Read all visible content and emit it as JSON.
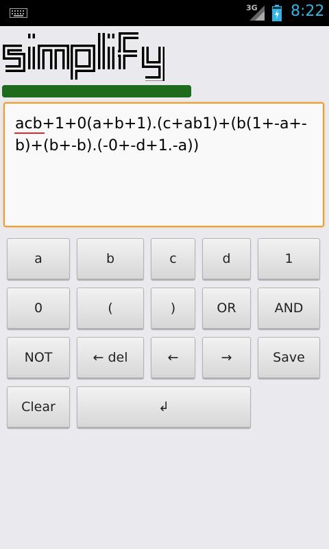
{
  "status_bar": {
    "network": "3G",
    "time": "8:22"
  },
  "app": {
    "title": "simplify",
    "progress_fraction": 1.0
  },
  "expression": {
    "underlined_part": "acb",
    "rest": "+1+0(a+b+1).(c+ab1)+(b(1+-a+-b)+(b+-b).(-0+-d+1.-a))"
  },
  "keypad": {
    "a": "a",
    "b": "b",
    "c": "c",
    "d": "d",
    "one": "1",
    "zero": "0",
    "open_paren": "(",
    "close_paren": ")",
    "or": "OR",
    "and": "AND",
    "not": "NOT",
    "del": "← del",
    "left": "←",
    "right": "→",
    "save": "Save",
    "clear": "Clear",
    "enter": "↲"
  },
  "colors": {
    "statusbar_bg": "#000000",
    "accent_blue": "#33b5e5",
    "progress_green": "#1e6b1e",
    "editor_focus_orange": "#f39a2a",
    "spellcheck_red": "#e0282e"
  }
}
